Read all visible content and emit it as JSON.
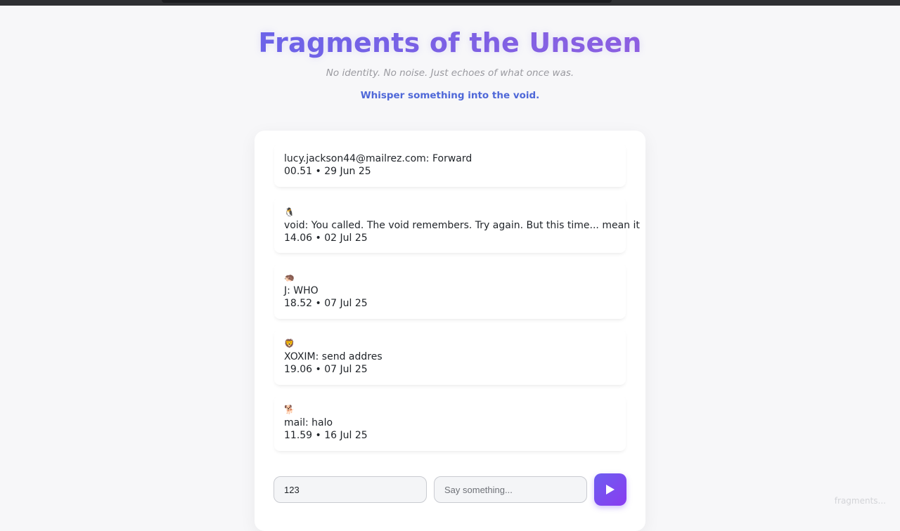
{
  "header": {
    "title": "Fragments of the Unseen",
    "subtitle": "No identity. No noise. Just echoes of what once was.",
    "tagline": "Whisper something into the void."
  },
  "messages": [
    {
      "emoji": "",
      "text": "lucy.jackson44@mailrez.com: Forward",
      "time": "00.51 • 29 Jun 25"
    },
    {
      "emoji": "🐧",
      "text": "void: You called. The void remembers. Try again. But this time... mean it",
      "time": "14.06 • 02 Jul 25"
    },
    {
      "emoji": "🦔",
      "text": "J: WHO",
      "time": "18.52 • 07 Jul 25"
    },
    {
      "emoji": "🦁",
      "text": "XOXIM: send addres",
      "time": "19.06 • 07 Jul 25"
    },
    {
      "emoji": "🐕",
      "text": "mail: halo",
      "time": "11.59 • 16 Jul 25"
    }
  ],
  "composer": {
    "name_value": "123",
    "message_placeholder": "Say something..."
  },
  "footer": {
    "watermark": "fragments..."
  },
  "colors": {
    "title_gradient_start": "#6b63e8",
    "title_gradient_end": "#8f5fe0",
    "tagline": "#4f68d8",
    "send_button": "#7b4cf0"
  }
}
